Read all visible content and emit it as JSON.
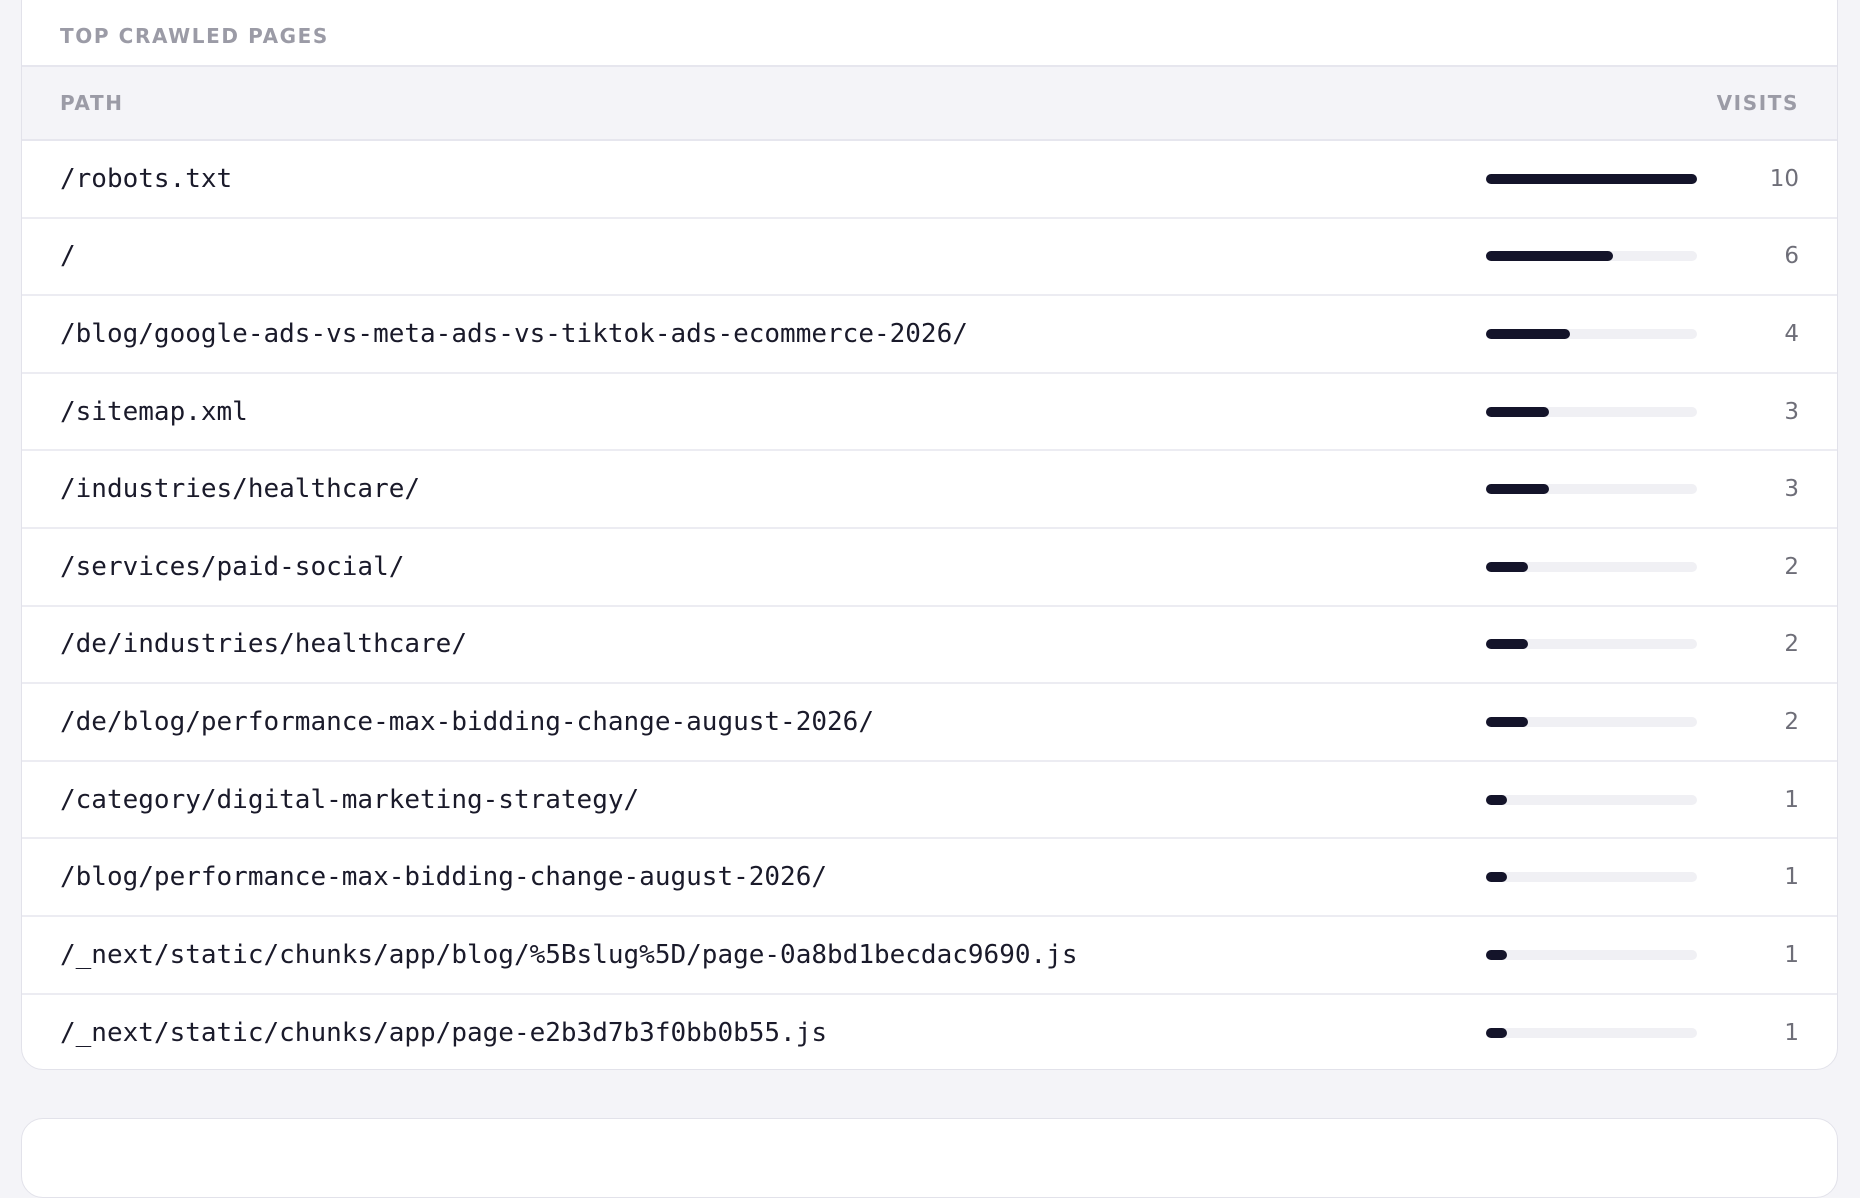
{
  "panel": {
    "title": "TOP CRAWLED PAGES",
    "columns": {
      "path": "PATH",
      "visits": "VISITS"
    }
  },
  "colors": {
    "bar": "#14142a",
    "track": "#f0f0f4"
  },
  "rows": [
    {
      "path": "/robots.txt",
      "visits": "10",
      "value": 10
    },
    {
      "path": "/",
      "visits": "6",
      "value": 6
    },
    {
      "path": "/blog/google-ads-vs-meta-ads-vs-tiktok-ads-ecommerce-2026/",
      "visits": "4",
      "value": 4
    },
    {
      "path": "/sitemap.xml",
      "visits": "3",
      "value": 3
    },
    {
      "path": "/industries/healthcare/",
      "visits": "3",
      "value": 3
    },
    {
      "path": "/services/paid-social/",
      "visits": "2",
      "value": 2
    },
    {
      "path": "/de/industries/healthcare/",
      "visits": "2",
      "value": 2
    },
    {
      "path": "/de/blog/performance-max-bidding-change-august-2026/",
      "visits": "2",
      "value": 2
    },
    {
      "path": "/category/digital-marketing-strategy/",
      "visits": "1",
      "value": 1
    },
    {
      "path": "/blog/performance-max-bidding-change-august-2026/",
      "visits": "1",
      "value": 1
    },
    {
      "path": "/_next/static/chunks/app/blog/%5Bslug%5D/page-0a8bd1becdac9690.js",
      "visits": "1",
      "value": 1
    },
    {
      "path": "/_next/static/chunks/app/page-e2b3d7b3f0bb0b55.js",
      "visits": "1",
      "value": 1
    }
  ]
}
